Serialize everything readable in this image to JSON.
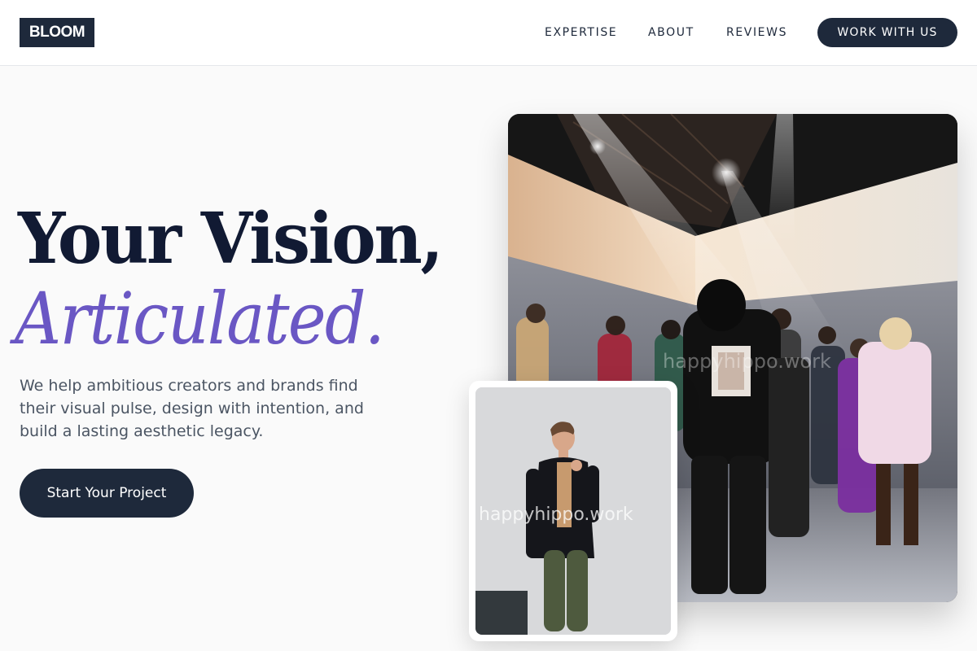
{
  "header": {
    "logo": "BLOOM",
    "nav": {
      "expertise": "EXPERTISE",
      "about": "ABOUT",
      "reviews": "REVIEWS"
    },
    "cta_label": "WORK WITH US"
  },
  "hero": {
    "headline_line1": "Your Vision,",
    "headline_line2": "Articulated.",
    "subtitle": "We help ambitious creators and brands find their visual pulse, design with intention, and build a lasting aesthetic legacy.",
    "cta_label": "Start Your Project"
  },
  "images": {
    "main_watermark": "happyhippo.work",
    "inset_watermark": "happyhippo.work"
  },
  "colors": {
    "primary_dark": "#1e293b",
    "accent_purple": "#6a57c4",
    "background": "#fafafa"
  }
}
